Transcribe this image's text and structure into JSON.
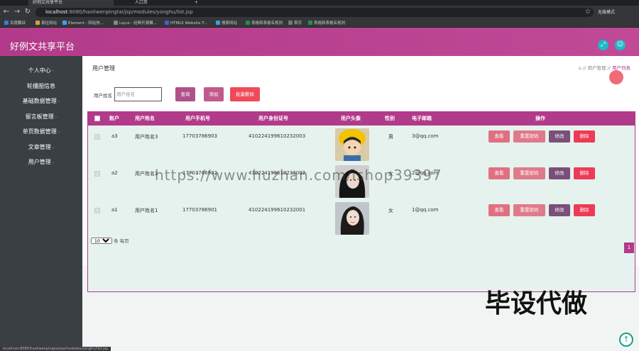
{
  "browser": {
    "tabs": [
      "好例文共享平台",
      "人口页"
    ],
    "new_tab": "+",
    "url_host": "localhost",
    "url_rest": ":8080/haoliwenpingtai/jsp/modules/yonghu/list.jsp",
    "profile": "无痕模式",
    "bookmarks": [
      "百度翻译",
      "易拉网站",
      "Element - 网站快...",
      "Layui - 经典开源模...",
      "HTML5 Website T...",
      "搜索网站",
      "表格和表格名规则",
      "首页",
      "表格和表格名规则"
    ],
    "status_url": "localhost:8080/haoliwenpingtai/jsp/modules/yonghu/list.jsp"
  },
  "header": {
    "brand": "好例文共享平台"
  },
  "sidebar": {
    "items": [
      "个人中心",
      "轮播图信息",
      "基础数据管理",
      "留言板管理",
      "单页数据管理",
      "文章管理",
      "用户管理"
    ]
  },
  "page": {
    "title": "用户管理",
    "breadcrumb_home": "⌂ // 用户管理 //",
    "breadcrumb_current": "用户列表"
  },
  "search": {
    "label": "用户姓名",
    "placeholder": "用户姓名",
    "query_label": "查询",
    "add_label": "添加",
    "batch_delete_label": "批量删除"
  },
  "table": {
    "headers": [
      "账户",
      "用户姓名",
      "用户手机号",
      "用户身份证号",
      "用户头像",
      "性别",
      "电子邮箱",
      "操作"
    ],
    "rows": [
      {
        "account": "a3",
        "name": "用户姓名3",
        "phone": "17703786903",
        "idcard": "410224199610232003",
        "gender": "男",
        "email": "3@qq.com"
      },
      {
        "account": "a2",
        "name": "用户姓名2",
        "phone": "17703786902",
        "idcard": "410224199610232002",
        "gender": "女",
        "email": "2@qq.com"
      },
      {
        "account": "a1",
        "name": "用户姓名1",
        "phone": "17703786901",
        "idcard": "410224199610232001",
        "gender": "女",
        "email": "1@qq.com"
      }
    ],
    "actions": {
      "view": "查看",
      "reset": "重置密码",
      "edit": "修改",
      "delete": "删除"
    }
  },
  "pagination": {
    "page_size": "10",
    "per_page_label": "条 每页",
    "current_page": "1"
  },
  "overlay": {
    "watermark": "https://www.huzhan.com/ishop39397",
    "stamp": "毕设代做"
  },
  "colors": {
    "accent": "#b23a8a",
    "sidebar": "#3a3f44",
    "teal": "#1fb9c7",
    "danger": "#ee3b55"
  }
}
